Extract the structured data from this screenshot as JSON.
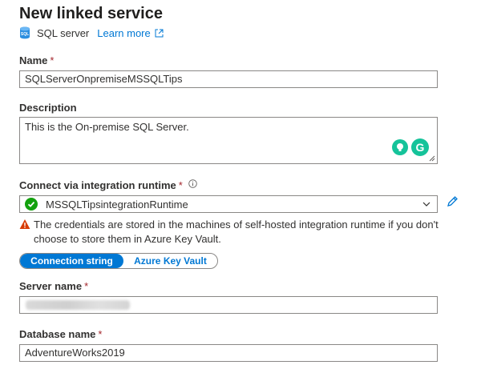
{
  "header": {
    "title": "New linked service",
    "service_name": "SQL server",
    "learn_more": "Learn more"
  },
  "fields": {
    "name": {
      "label": "Name",
      "required": "*",
      "value": "SQLServerOnpremiseMSSQLTips"
    },
    "description": {
      "label": "Description",
      "value": "This is the On-premise SQL Server."
    },
    "runtime": {
      "label": "Connect via integration runtime",
      "required": "*",
      "value": "MSSQLTipsintegrationRuntime"
    },
    "warning": "The credentials are stored in the machines of self-hosted integration runtime if you don't choose to store them in Azure Key Vault.",
    "auth_toggle": {
      "options": [
        "Connection string",
        "Azure Key Vault"
      ],
      "selected": "Connection string"
    },
    "server_name": {
      "label": "Server name",
      "required": "*",
      "value": ""
    },
    "database_name": {
      "label": "Database name",
      "required": "*",
      "value": "AdventureWorks2019"
    }
  },
  "colors": {
    "accent": "#0078d4",
    "required": "#a4262c",
    "success": "#13a10e",
    "warning": "#d83b01",
    "grammarly": "#15c39a"
  }
}
